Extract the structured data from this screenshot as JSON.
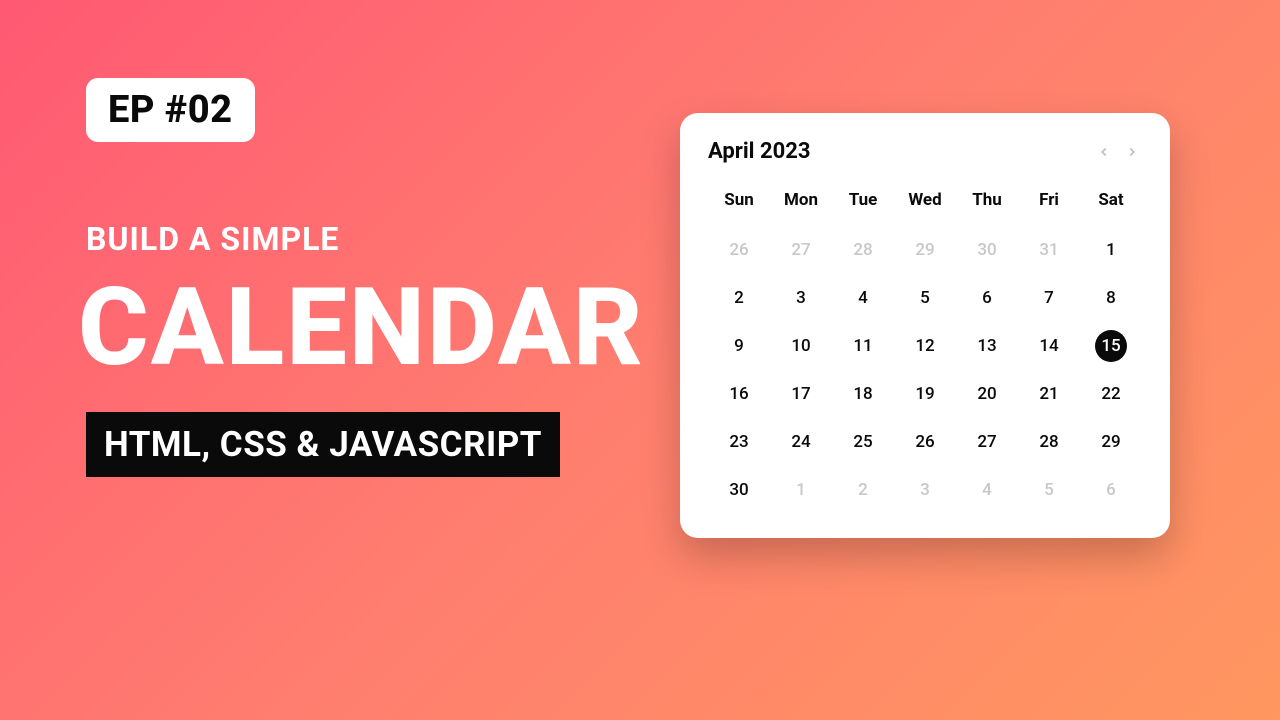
{
  "ep_badge": "EP #02",
  "build_text": "BUILD A SIMPLE",
  "calendar_title": "CALENDAR",
  "tech_stack": "HTML, CSS & JAVASCRIPT",
  "calendar": {
    "month_label": "April 2023",
    "weekdays": [
      "Sun",
      "Mon",
      "Tue",
      "Wed",
      "Thu",
      "Fri",
      "Sat"
    ],
    "days": [
      {
        "n": "26",
        "muted": true,
        "selected": false
      },
      {
        "n": "27",
        "muted": true,
        "selected": false
      },
      {
        "n": "28",
        "muted": true,
        "selected": false
      },
      {
        "n": "29",
        "muted": true,
        "selected": false
      },
      {
        "n": "30",
        "muted": true,
        "selected": false
      },
      {
        "n": "31",
        "muted": true,
        "selected": false
      },
      {
        "n": "1",
        "muted": false,
        "selected": false
      },
      {
        "n": "2",
        "muted": false,
        "selected": false
      },
      {
        "n": "3",
        "muted": false,
        "selected": false
      },
      {
        "n": "4",
        "muted": false,
        "selected": false
      },
      {
        "n": "5",
        "muted": false,
        "selected": false
      },
      {
        "n": "6",
        "muted": false,
        "selected": false
      },
      {
        "n": "7",
        "muted": false,
        "selected": false
      },
      {
        "n": "8",
        "muted": false,
        "selected": false
      },
      {
        "n": "9",
        "muted": false,
        "selected": false
      },
      {
        "n": "10",
        "muted": false,
        "selected": false
      },
      {
        "n": "11",
        "muted": false,
        "selected": false
      },
      {
        "n": "12",
        "muted": false,
        "selected": false
      },
      {
        "n": "13",
        "muted": false,
        "selected": false
      },
      {
        "n": "14",
        "muted": false,
        "selected": false
      },
      {
        "n": "15",
        "muted": false,
        "selected": true
      },
      {
        "n": "16",
        "muted": false,
        "selected": false
      },
      {
        "n": "17",
        "muted": false,
        "selected": false
      },
      {
        "n": "18",
        "muted": false,
        "selected": false
      },
      {
        "n": "19",
        "muted": false,
        "selected": false
      },
      {
        "n": "20",
        "muted": false,
        "selected": false
      },
      {
        "n": "21",
        "muted": false,
        "selected": false
      },
      {
        "n": "22",
        "muted": false,
        "selected": false
      },
      {
        "n": "23",
        "muted": false,
        "selected": false
      },
      {
        "n": "24",
        "muted": false,
        "selected": false
      },
      {
        "n": "25",
        "muted": false,
        "selected": false
      },
      {
        "n": "26",
        "muted": false,
        "selected": false
      },
      {
        "n": "27",
        "muted": false,
        "selected": false
      },
      {
        "n": "28",
        "muted": false,
        "selected": false
      },
      {
        "n": "29",
        "muted": false,
        "selected": false
      },
      {
        "n": "30",
        "muted": false,
        "selected": false
      },
      {
        "n": "1",
        "muted": true,
        "selected": false
      },
      {
        "n": "2",
        "muted": true,
        "selected": false
      },
      {
        "n": "3",
        "muted": true,
        "selected": false
      },
      {
        "n": "4",
        "muted": true,
        "selected": false
      },
      {
        "n": "5",
        "muted": true,
        "selected": false
      },
      {
        "n": "6",
        "muted": true,
        "selected": false
      }
    ]
  }
}
